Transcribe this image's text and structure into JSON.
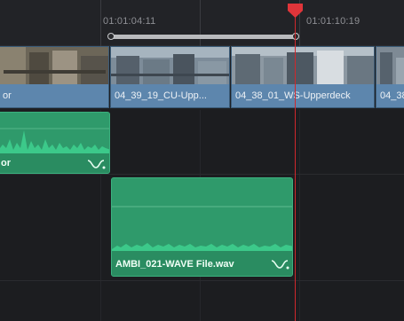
{
  "ruler": {
    "timecode_left": "01:01:04:11",
    "timecode_right": "01:01:10:19"
  },
  "video_track": {
    "clips": [
      {
        "label": "or"
      },
      {
        "label": "04_39_19_CU-Upp..."
      },
      {
        "label": "04_38_01_WS-Upperdeck"
      },
      {
        "label": "04_38"
      }
    ]
  },
  "audio_track": {
    "clips": [
      {
        "label": "or",
        "fade_icon": "fade-curve-icon"
      },
      {
        "label": "AMBI_021-WAVE File.wav",
        "fade_icon": "fade-curve-icon"
      }
    ]
  },
  "colors": {
    "video_clip": "#5d86ad",
    "audio_clip": "#2f9a6b",
    "playhead": "#d0282c"
  }
}
